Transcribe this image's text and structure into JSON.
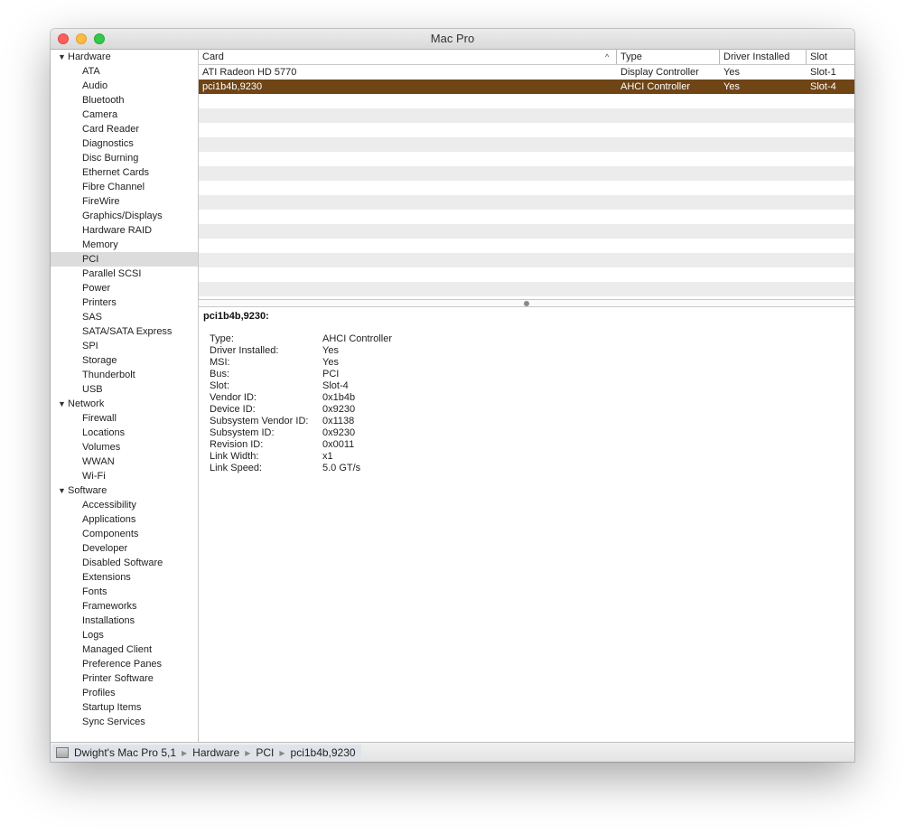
{
  "window": {
    "title": "Mac Pro"
  },
  "sidebar": {
    "groups": [
      {
        "label": "Hardware",
        "items": [
          "ATA",
          "Audio",
          "Bluetooth",
          "Camera",
          "Card Reader",
          "Diagnostics",
          "Disc Burning",
          "Ethernet Cards",
          "Fibre Channel",
          "FireWire",
          "Graphics/Displays",
          "Hardware RAID",
          "Memory",
          "PCI",
          "Parallel SCSI",
          "Power",
          "Printers",
          "SAS",
          "SATA/SATA Express",
          "SPI",
          "Storage",
          "Thunderbolt",
          "USB"
        ]
      },
      {
        "label": "Network",
        "items": [
          "Firewall",
          "Locations",
          "Volumes",
          "WWAN",
          "Wi-Fi"
        ]
      },
      {
        "label": "Software",
        "items": [
          "Accessibility",
          "Applications",
          "Components",
          "Developer",
          "Disabled Software",
          "Extensions",
          "Fonts",
          "Frameworks",
          "Installations",
          "Logs",
          "Managed Client",
          "Preference Panes",
          "Printer Software",
          "Profiles",
          "Startup Items",
          "Sync Services"
        ]
      }
    ],
    "selected": "PCI"
  },
  "table": {
    "columns": [
      "Card",
      "Type",
      "Driver Installed",
      "Slot"
    ],
    "sort_indicator": "^",
    "rows": [
      {
        "card": "ATI Radeon HD 5770",
        "type": "Display Controller",
        "driver": "Yes",
        "slot": "Slot-1"
      },
      {
        "card": "pci1b4b,9230",
        "type": "AHCI Controller",
        "driver": "Yes",
        "slot": "Slot-4"
      }
    ],
    "selected_index": 1
  },
  "detail": {
    "title": "pci1b4b,9230:",
    "fields": [
      {
        "key": "Type:",
        "value": "AHCI Controller"
      },
      {
        "key": "Driver Installed:",
        "value": "Yes"
      },
      {
        "key": "MSI:",
        "value": "Yes"
      },
      {
        "key": "Bus:",
        "value": "PCI"
      },
      {
        "key": "Slot:",
        "value": "Slot-4"
      },
      {
        "key": "Vendor ID:",
        "value": "0x1b4b"
      },
      {
        "key": "Device ID:",
        "value": "0x9230"
      },
      {
        "key": "Subsystem Vendor ID:",
        "value": "0x1138"
      },
      {
        "key": "Subsystem ID:",
        "value": "0x9230"
      },
      {
        "key": "Revision ID:",
        "value": "0x0011"
      },
      {
        "key": "Link Width:",
        "value": "x1"
      },
      {
        "key": "Link Speed:",
        "value": "5.0 GT/s"
      }
    ]
  },
  "breadcrumb": [
    "Dwight's Mac Pro 5,1",
    "Hardware",
    "PCI",
    "pci1b4b,9230"
  ],
  "colors": {
    "selection": "#6f4516",
    "sidebar_selection": "#dcdcdc",
    "stripe": "#ececec"
  }
}
